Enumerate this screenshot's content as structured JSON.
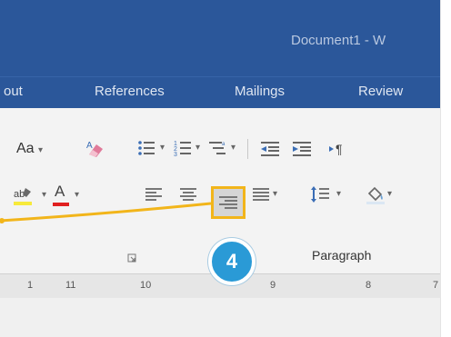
{
  "window": {
    "title": "Document1  -  W",
    "accent_color": "#2b579a"
  },
  "tabs": [
    {
      "label": "out"
    },
    {
      "label": "References"
    },
    {
      "label": "Mailings"
    },
    {
      "label": "Review"
    }
  ],
  "ribbon": {
    "font_case": "Aa",
    "font_color_letter": "A",
    "group_label": "Paragraph"
  },
  "callout": {
    "number": "4",
    "highlight_color": "#f2b51a",
    "badge_color": "#2a9ad6"
  },
  "ruler": {
    "ticks": [
      "1",
      "11",
      "10",
      "9",
      "8",
      "7"
    ]
  }
}
